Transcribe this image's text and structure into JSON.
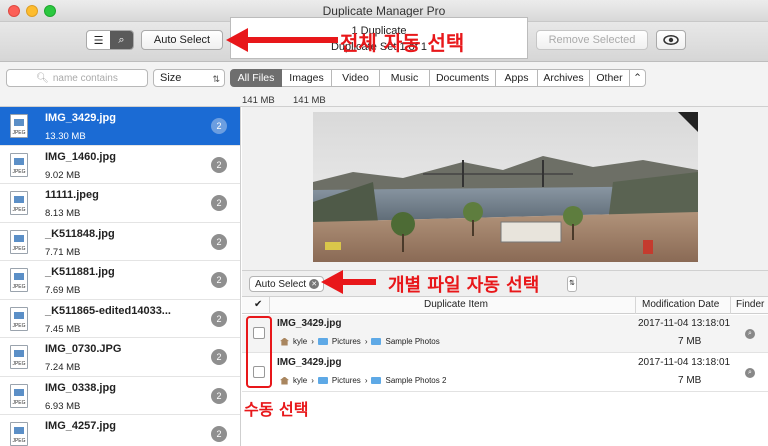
{
  "window": {
    "title": "Duplicate Manager Pro"
  },
  "toolbar": {
    "auto_select_label": "Auto Select",
    "remove_selected_label": "Remove Selected",
    "center_line1": "1 Duplicate",
    "center_line2": "Duplicate Set 1 of 1",
    "view_list_icon": "list-view-icon",
    "view_search_icon": "magnifier-icon",
    "preview_icon": "eye-icon"
  },
  "annotations": {
    "top": "전체 자동 선택",
    "middle": "개별 파일 자동 선택",
    "bottom": "수동 선택"
  },
  "filter": {
    "search_placeholder": "name contains",
    "sort_selected": "Size",
    "tabs": [
      "All Files",
      "Images",
      "Video",
      "Music",
      "Documents",
      "Apps",
      "Archives",
      "Other"
    ],
    "active_tab": "All Files",
    "tab_sizes": [
      "141 MB",
      "141 MB"
    ]
  },
  "files": [
    {
      "name": "IMG_3429.jpg",
      "size": "13.30 MB",
      "count": "2",
      "selected": true
    },
    {
      "name": "IMG_1460.jpg",
      "size": "9.02 MB",
      "count": "2"
    },
    {
      "name": "11111.jpeg",
      "size": "8.13 MB",
      "count": "2"
    },
    {
      "name": "_K511848.jpg",
      "size": "7.71 MB",
      "count": "2"
    },
    {
      "name": "_K511881.jpg",
      "size": "7.69 MB",
      "count": "2"
    },
    {
      "name": "_K511865-edited14033...",
      "size": "7.45 MB",
      "count": "2"
    },
    {
      "name": "IMG_0730.JPG",
      "size": "7.24 MB",
      "count": "2"
    },
    {
      "name": "IMG_0338.jpg",
      "size": "6.93 MB",
      "count": "2"
    },
    {
      "name": "IMG_4257.jpg",
      "size": "",
      "count": "2"
    }
  ],
  "detail": {
    "auto_select_chip": "Auto Select",
    "columns": {
      "check": "✔",
      "item": "Duplicate Item",
      "date": "Modification Date",
      "finder": "Finder"
    },
    "rows": [
      {
        "name": "IMG_3429.jpg",
        "path": [
          "kyle",
          "Pictures",
          "Sample Photos"
        ],
        "date": "2017-11-04 13:18:01",
        "size": "7 MB"
      },
      {
        "name": "IMG_3429.jpg",
        "path": [
          "kyle",
          "Pictures",
          "Sample Photos 2"
        ],
        "date": "2017-11-04 13:18:01",
        "size": "7 MB"
      }
    ]
  },
  "colors": {
    "selection": "#1b6bd4",
    "annotation": "#e8171a"
  }
}
